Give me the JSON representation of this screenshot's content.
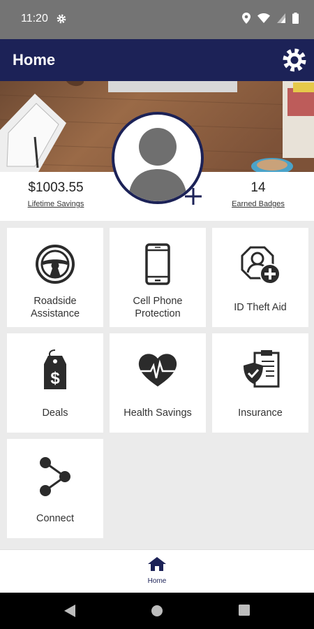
{
  "status_bar": {
    "time": "11:20"
  },
  "app_bar": {
    "title": "Home"
  },
  "stats": {
    "lifetime_savings_value": "$1003.55",
    "lifetime_savings_label": "Lifetime Savings",
    "earned_badges_value": "14",
    "earned_badges_label": "Earned Badges"
  },
  "tiles": [
    {
      "label": "Roadside\nAssistance",
      "icon": "steering-wheel-icon"
    },
    {
      "label": "Cell Phone\nProtection",
      "icon": "cell-phone-icon"
    },
    {
      "label": "ID Theft Aid",
      "icon": "id-theft-icon"
    },
    {
      "label": "Deals",
      "icon": "price-tag-icon"
    },
    {
      "label": "Health Savings",
      "icon": "heart-pulse-icon"
    },
    {
      "label": "Insurance",
      "icon": "insurance-clipboard-icon"
    },
    {
      "label": "Connect",
      "icon": "share-icon"
    }
  ],
  "bottom_nav": {
    "home_label": "Home"
  },
  "colors": {
    "brand_navy": "#1c2257",
    "status_bar": "#747474",
    "background": "#ebebeb"
  }
}
